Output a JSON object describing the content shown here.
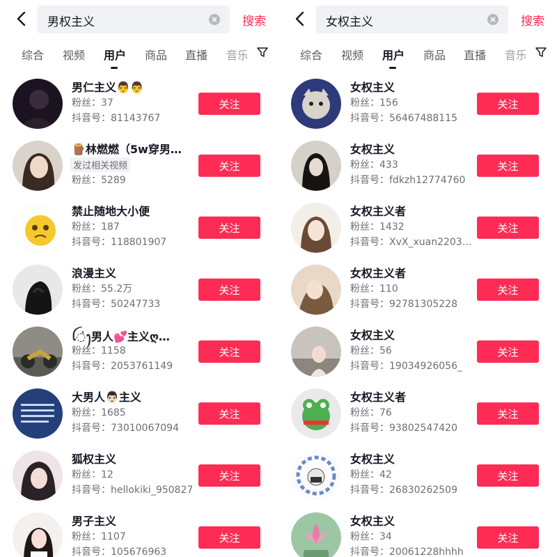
{
  "colors": {
    "accent": "#fe2c55",
    "search_bg": "#f1f2f5",
    "text": "#161823",
    "muted": "#6d6e75"
  },
  "left": {
    "search": {
      "query": "男权主义",
      "button": "搜索"
    },
    "tabs": [
      "综合",
      "视频",
      "用户",
      "商品",
      "直播",
      "音乐"
    ],
    "active_tab": "用户",
    "users": [
      {
        "name": "男仁主义👨👨",
        "fans": "粉丝：37",
        "id": "抖音号：81143767",
        "follow": "关注"
      },
      {
        "name": "🪵林燃燃（5w穿男…",
        "tag": "发过相关视频",
        "fans": "粉丝：5289",
        "follow": "关注"
      },
      {
        "name": "禁止随地大小便",
        "fans": "粉丝：187",
        "id": "抖音号：118801907",
        "follow": "关注"
      },
      {
        "name": "浪漫主义",
        "fans": "粉丝：55.2万",
        "id": "抖音号：50247733",
        "follow": "关注"
      },
      {
        "name": "ꪶ◌̍ꫂ男人💕主义ღ…",
        "fans": "粉丝：1158",
        "id": "抖音号：2053761149",
        "follow": "关注"
      },
      {
        "name": "大男人👨🏻主义",
        "fans": "粉丝：1685",
        "id": "抖音号：73010067094",
        "follow": "关注"
      },
      {
        "name": "狐权主义",
        "fans": "粉丝：12",
        "id": "抖音号：hellokiki_950827",
        "follow": "关注"
      },
      {
        "name": "男子主义",
        "fans": "粉丝：1107",
        "id": "抖音号：105676963",
        "follow": "关注"
      }
    ]
  },
  "right": {
    "search": {
      "query": "女权主义",
      "button": "搜索"
    },
    "tabs": [
      "综合",
      "视频",
      "用户",
      "商品",
      "直播",
      "音乐"
    ],
    "active_tab": "用户",
    "users": [
      {
        "name": "女权主义",
        "fans": "粉丝：156",
        "id": "抖音号：56467488115",
        "follow": "关注"
      },
      {
        "name": "女权主义",
        "fans": "粉丝：433",
        "id": "抖音号：fdkzh12774760",
        "follow": "关注"
      },
      {
        "name": "女权主义者",
        "fans": "粉丝：1432",
        "id": "抖音号：XvX_xuan2203…",
        "follow": "关注"
      },
      {
        "name": "女权主义者",
        "fans": "粉丝：110",
        "id": "抖音号：92781305228",
        "follow": "关注"
      },
      {
        "name": "女权主义",
        "fans": "粉丝：56",
        "id": "抖音号：19034926056_",
        "follow": "关注"
      },
      {
        "name": "女权主义者",
        "fans": "粉丝：76",
        "id": "抖音号：93802547420",
        "follow": "关注"
      },
      {
        "name": "女权主义",
        "fans": "粉丝：42",
        "id": "抖音号：26830262509",
        "follow": "关注"
      },
      {
        "name": "女权主义",
        "fans": "粉丝：34",
        "id": "抖音号：20061228hhhh",
        "follow": "关注"
      }
    ]
  }
}
